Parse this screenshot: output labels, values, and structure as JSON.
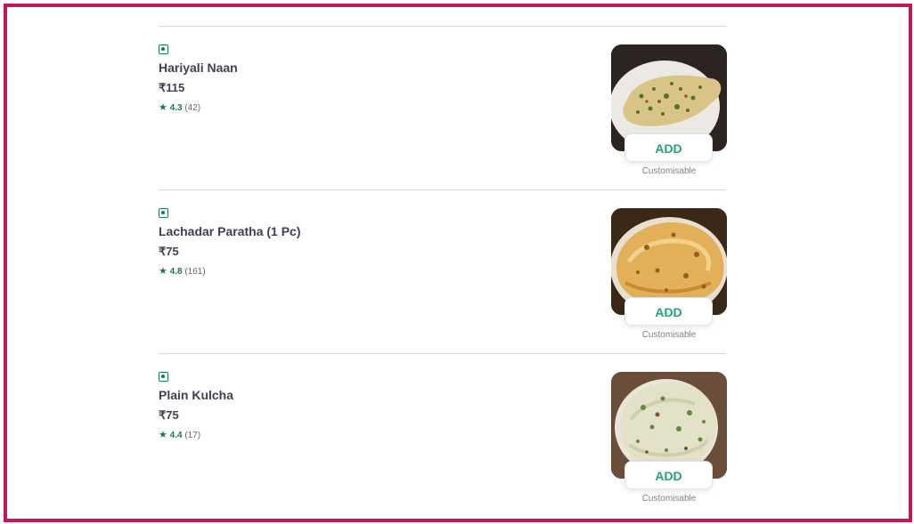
{
  "menu_items": [
    {
      "name": "Hariyali Naan",
      "price": "₹115",
      "rating": "4.3",
      "rating_count": "(42)",
      "add_label": "ADD",
      "customisable_label": "Customisable",
      "is_veg": true
    },
    {
      "name": "Lachadar Paratha (1 Pc)",
      "price": "₹75",
      "rating": "4.8",
      "rating_count": "(161)",
      "add_label": "ADD",
      "customisable_label": "Customisable",
      "is_veg": true
    },
    {
      "name": "Plain Kulcha",
      "price": "₹75",
      "rating": "4.4",
      "rating_count": "(17)",
      "add_label": "ADD",
      "customisable_label": "Customisable",
      "is_veg": true
    }
  ],
  "colors": {
    "frame_border": "#c2185b",
    "veg_green": "#1b7b4e",
    "add_green": "#1ba672",
    "text_dark": "#3d4152",
    "text_muted": "#7e808c"
  },
  "icons": {
    "veg": "veg-indicator-icon",
    "star": "star-icon"
  }
}
